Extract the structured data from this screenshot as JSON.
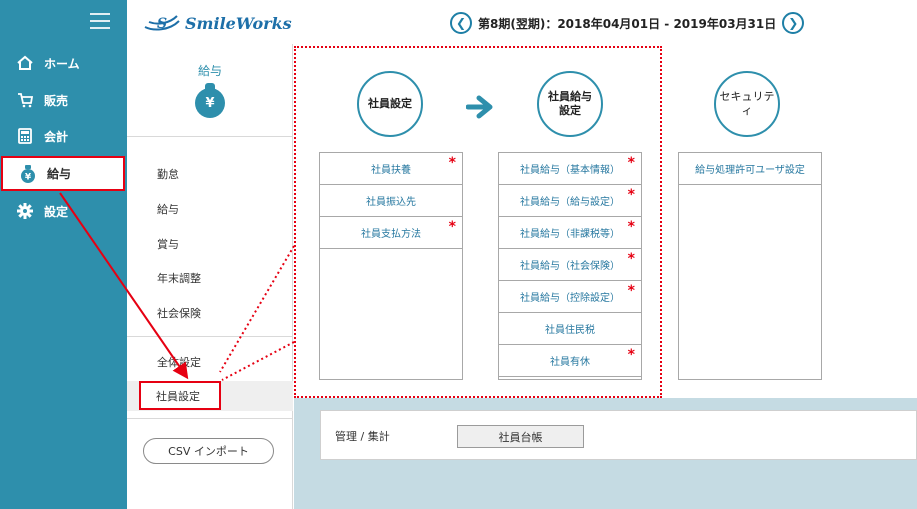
{
  "sidebar": {
    "items": [
      {
        "label": "ホーム",
        "icon": "home-icon"
      },
      {
        "label": "販売",
        "icon": "cart-icon"
      },
      {
        "label": "会計",
        "icon": "calculator-icon"
      },
      {
        "label": "給与",
        "icon": "money-bag-icon"
      },
      {
        "label": "設定",
        "icon": "gear-icon"
      }
    ]
  },
  "header": {
    "logo_text": "SmileWorks",
    "period": "第8期(翌期)：2018年04月01日 - 2019年03月31日"
  },
  "submenu": {
    "title": "給与",
    "badge": "¥",
    "items": [
      "勤怠",
      "給与",
      "賞与",
      "年末調整",
      "社会保険",
      "全体設定",
      "社員設定"
    ],
    "csv_button": "CSV インポート"
  },
  "flow": {
    "step1": "社員設定",
    "step2_line1": "社員給与",
    "step2_line2": "設定",
    "step3": "セキュリティ"
  },
  "panels": {
    "employee": [
      {
        "label": "社員扶養",
        "required": "*"
      },
      {
        "label": "社員振込先",
        "required": ""
      },
      {
        "label": "社員支払方法",
        "required": "*"
      }
    ],
    "salary": [
      {
        "label": "社員給与（基本情報）",
        "required": "*"
      },
      {
        "label": "社員給与（給与設定）",
        "required": "*"
      },
      {
        "label": "社員給与（非課税等）",
        "required": "*"
      },
      {
        "label": "社員給与（社会保険）",
        "required": "*"
      },
      {
        "label": "社員給与（控除設定）",
        "required": "*"
      },
      {
        "label": "社員住民税",
        "required": ""
      },
      {
        "label": "社員有休",
        "required": "*"
      }
    ],
    "security": [
      {
        "label": "給与処理許可ユーザ設定",
        "required": ""
      }
    ]
  },
  "management": {
    "label": "管理 / 集計",
    "button": "社員台帳"
  },
  "colors": {
    "sidebar": "#2e8fac",
    "accent": "#1e7fa6",
    "highlight": "#e60012"
  }
}
